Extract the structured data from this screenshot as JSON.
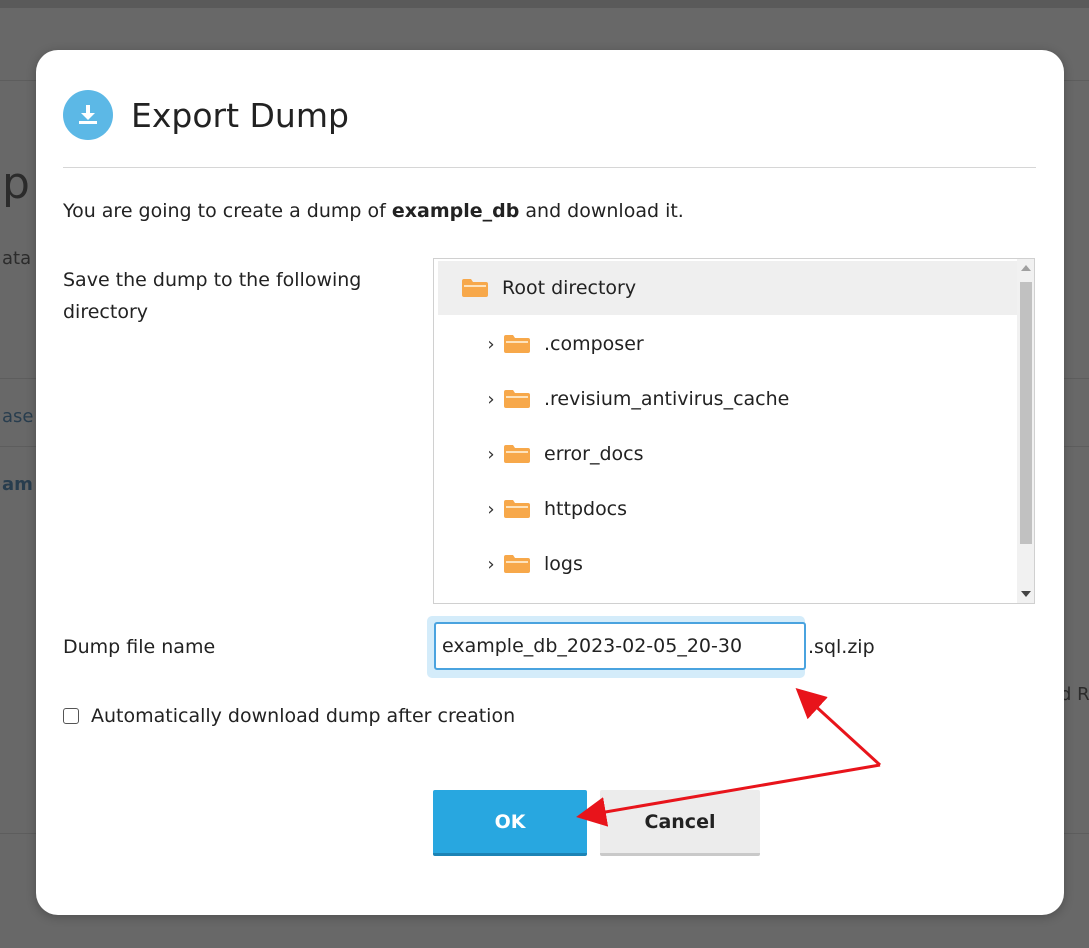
{
  "background": {
    "heading_fragment": "p",
    "subtext_fragment": "ata",
    "link_fragment_1": "ase",
    "link_fragment_2": "am",
    "right_fragment": "d R"
  },
  "dialog": {
    "title": "Export Dump",
    "intro": {
      "prefix": "You are going to create a dump of ",
      "db_name": "example_db",
      "suffix": " and download it."
    },
    "directory_label": "Save the dump to the following directory",
    "tree": {
      "root": "Root directory",
      "items": [
        {
          "name": ".composer"
        },
        {
          "name": ".revisium_antivirus_cache"
        },
        {
          "name": "error_docs"
        },
        {
          "name": "httpdocs"
        },
        {
          "name": "logs"
        }
      ]
    },
    "file_name_label": "Dump file name",
    "file_name_value": "example_db_2023-02-05_20-30",
    "file_suffix": ".sql.zip",
    "auto_download_label": "Automatically download dump after creation",
    "auto_download_checked": false,
    "ok_label": "OK",
    "cancel_label": "Cancel"
  },
  "icons": {
    "title_icon": "download-icon",
    "folder_icon": "folder-icon",
    "expand_icon": "chevron-right-icon"
  },
  "colors": {
    "accent": "#28a7e0",
    "title_icon_bg": "#5cb8e6",
    "folder": "#f7a84a",
    "annotation_arrow": "#e8141b"
  }
}
